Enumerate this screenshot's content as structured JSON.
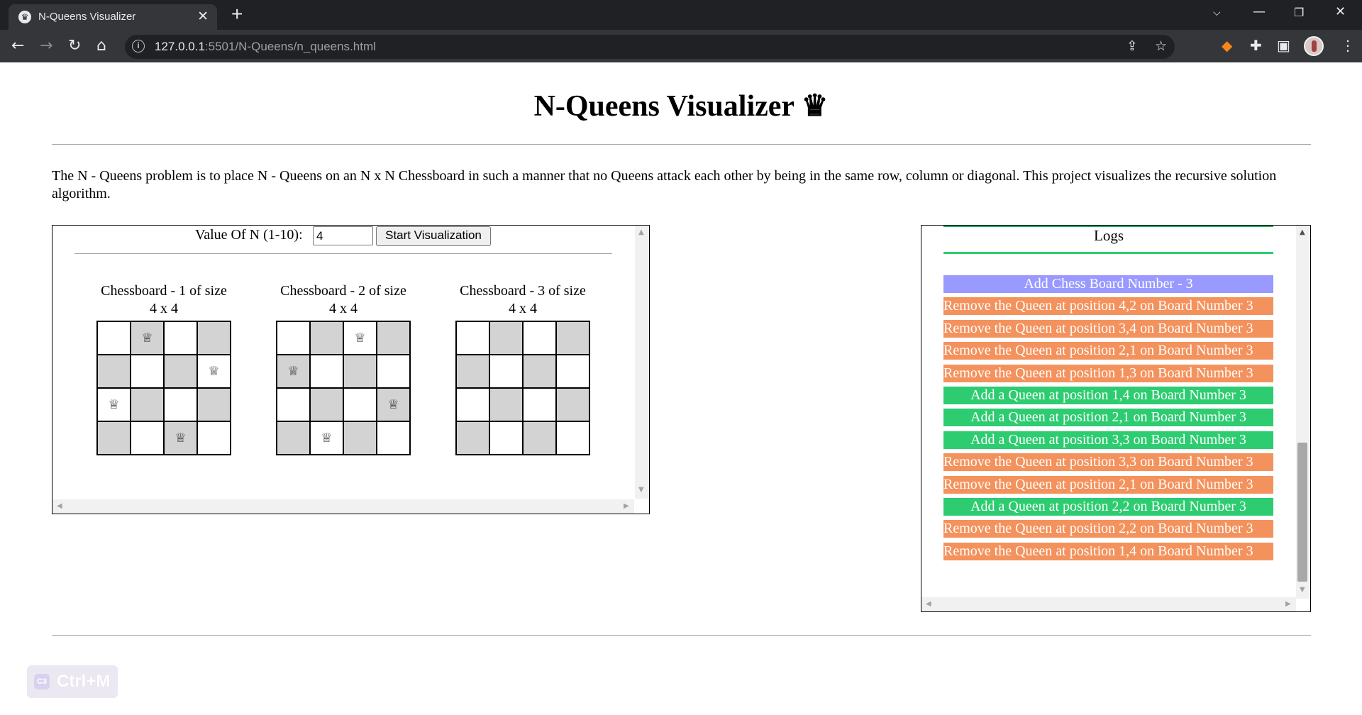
{
  "browser": {
    "tab_title": "N-Queens Visualizer",
    "tab_favicon": "♛",
    "url_host": "127.0.0.1",
    "url_path": ":5501/N-Queens/n_queens.html"
  },
  "page": {
    "title": "N-Queens Visualizer ♛",
    "intro": "The N - Queens problem is to place N - Queens on an N x N Chessboard in such a manner that no Queens attack each other by being in the same row, column or diagonal. This project visualizes the recursive solution algorithm."
  },
  "controls": {
    "label": "Value Of N (1-10):",
    "n_value": "4",
    "start_button": "Start Visualization"
  },
  "boards": [
    {
      "caption": "Chessboard - 1 of size",
      "size_label": "4 x 4",
      "queens": [
        [
          0,
          1
        ],
        [
          1,
          3
        ],
        [
          2,
          0
        ],
        [
          3,
          2
        ]
      ]
    },
    {
      "caption": "Chessboard - 2 of size",
      "size_label": "4 x 4",
      "queens": [
        [
          0,
          2
        ],
        [
          1,
          0
        ],
        [
          2,
          3
        ],
        [
          3,
          1
        ]
      ]
    },
    {
      "caption": "Chessboard - 3 of size",
      "size_label": "4 x 4",
      "queens": []
    }
  ],
  "queen_glyph": "♕",
  "logs": {
    "title": "Logs",
    "entries": [
      {
        "type": "add-board",
        "text": "Add Chess Board Number - 3"
      },
      {
        "type": "remove",
        "text": "Remove the Queen at position 4,2 on Board Number 3"
      },
      {
        "type": "remove",
        "text": "Remove the Queen at position 3,4 on Board Number 3"
      },
      {
        "type": "remove",
        "text": "Remove the Queen at position 2,1 on Board Number 3"
      },
      {
        "type": "remove",
        "text": "Remove the Queen at position 1,3 on Board Number 3"
      },
      {
        "type": "add",
        "text": "Add a Queen at position 1,4 on Board Number 3"
      },
      {
        "type": "add",
        "text": "Add a Queen at position 2,1 on Board Number 3"
      },
      {
        "type": "add",
        "text": "Add a Queen at position 3,3 on Board Number 3"
      },
      {
        "type": "remove",
        "text": "Remove the Queen at position 3,3 on Board Number 3"
      },
      {
        "type": "remove",
        "text": "Remove the Queen at position 2,1 on Board Number 3"
      },
      {
        "type": "add",
        "text": "Add a Queen at position 2,2 on Board Number 3"
      },
      {
        "type": "remove",
        "text": "Remove the Queen at position 2,2 on Board Number 3"
      },
      {
        "type": "remove",
        "text": "Remove the Queen at position 1,4 on Board Number 3"
      }
    ]
  },
  "overlay": {
    "shortcut": "Ctrl+M",
    "icon": "C3"
  },
  "colors": {
    "add_board": "#9999ff",
    "remove": "#f4925d",
    "add": "#2ecc71",
    "dark_square": "#d3d3d3"
  }
}
